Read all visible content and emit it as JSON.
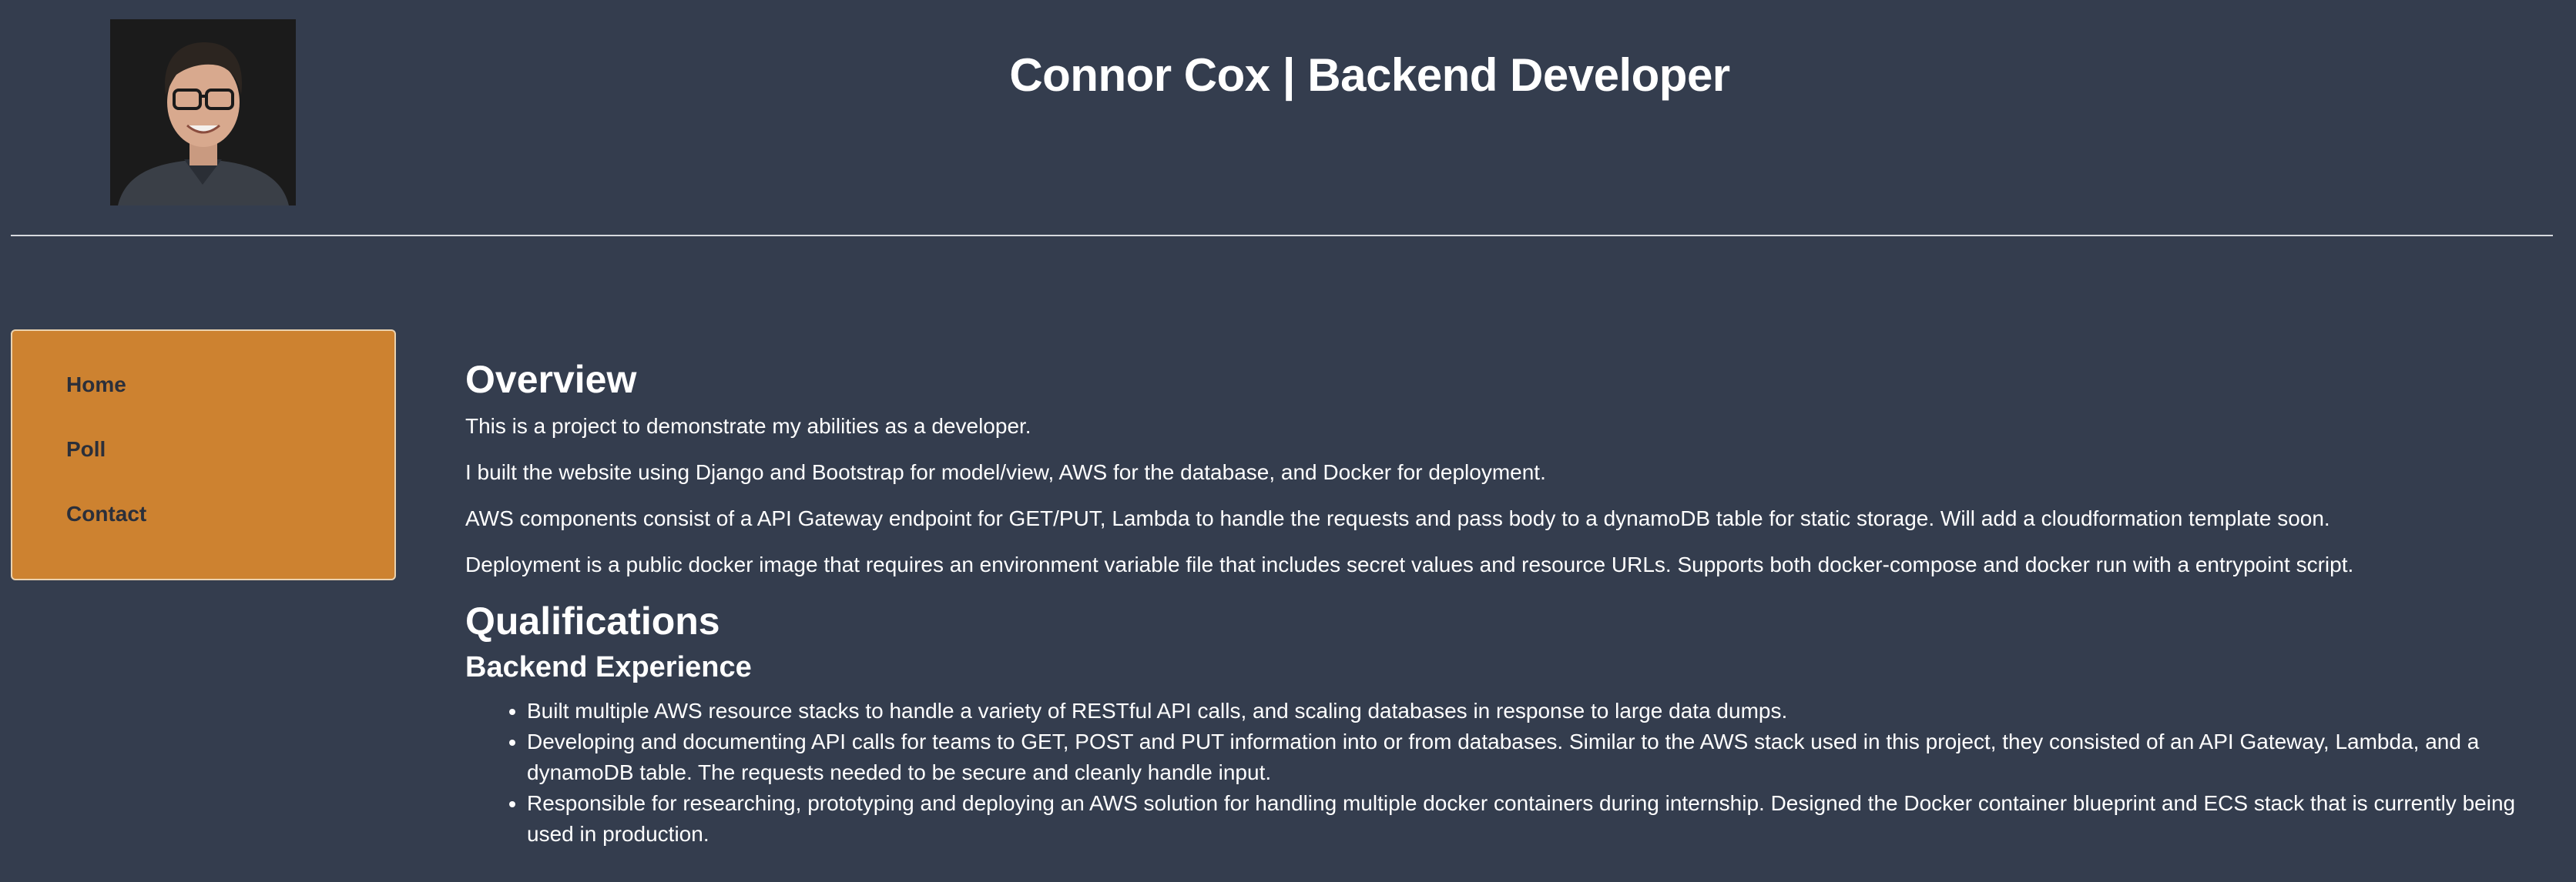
{
  "header": {
    "title": "Connor Cox | Backend Developer"
  },
  "sidebar": {
    "items": [
      {
        "label": "Home"
      },
      {
        "label": "Poll"
      },
      {
        "label": "Contact"
      }
    ]
  },
  "overview": {
    "heading": "Overview",
    "paragraphs": [
      "This is a project to demonstrate my abilities as a developer.",
      "I built the website using Django and Bootstrap for model/view, AWS for the database, and Docker for deployment.",
      "AWS components consist of a API Gateway endpoint for GET/PUT, Lambda to handle the requests and pass body to a dynamoDB table for static storage. Will add a cloudformation template soon.",
      "Deployment is a public docker image that requires an environment variable file that includes secret values and resource URLs. Supports both docker-compose and docker run with a entrypoint script."
    ]
  },
  "qualifications": {
    "heading": "Qualifications",
    "subheading": "Backend Experience",
    "items": [
      "Built multiple AWS resource stacks to handle a variety of RESTful API calls, and scaling databases in response to large data dumps.",
      "Developing and documenting API calls for teams to GET, POST and PUT information into or from databases. Similar to the AWS stack used in this project, they consisted of an API Gateway, Lambda, and a dynamoDB table. The requests needed to be secure and cleanly handle input.",
      "Responsible for researching, prototyping and deploying an AWS solution for handling multiple docker containers during internship. Designed the Docker container blueprint and ECS stack that is currently being used in production."
    ]
  },
  "colors": {
    "background": "#343d4e",
    "sidebar": "#cd8230",
    "nav_text": "#2b2f3a",
    "text": "#ffffff"
  }
}
